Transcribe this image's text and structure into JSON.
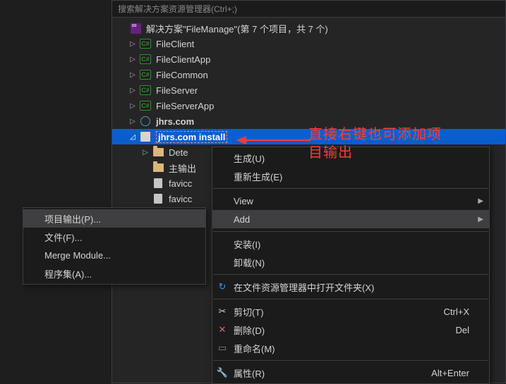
{
  "search": {
    "placeholder": "搜索解决方案资源管理器(Ctrl+;)"
  },
  "solution": {
    "label": "解决方案\"FileManage\"(第 7 个项目，共 7 个)"
  },
  "projects": {
    "p0": "FileClient",
    "p1": "FileClientApp",
    "p2": "FileCommon",
    "p3": "FileServer",
    "p4": "FileServerApp",
    "p5": "jhrs.com",
    "p6": "jhrs.com install"
  },
  "children": {
    "c0": "Dete",
    "c1": "主输出",
    "c2": "favicc",
    "c3": "favicc"
  },
  "context_menu": {
    "build": "生成(U)",
    "rebuild": "重新生成(E)",
    "view": "View",
    "add": "Add",
    "install": "安装(I)",
    "unload": "卸载(N)",
    "open_folder": "在文件资源管理器中打开文件夹(X)",
    "cut": "剪切(T)",
    "cut_sc": "Ctrl+X",
    "delete": "删除(D)",
    "delete_sc": "Del",
    "rename": "重命名(M)",
    "properties": "属性(R)",
    "properties_sc": "Alt+Enter"
  },
  "add_submenu": {
    "project_output": "项目输出(P)...",
    "file": "文件(F)...",
    "merge_module": "Merge Module...",
    "assembly": "程序集(A)..."
  },
  "annotation": {
    "line1": "直接右键也可添加项",
    "line2": "目输出"
  }
}
